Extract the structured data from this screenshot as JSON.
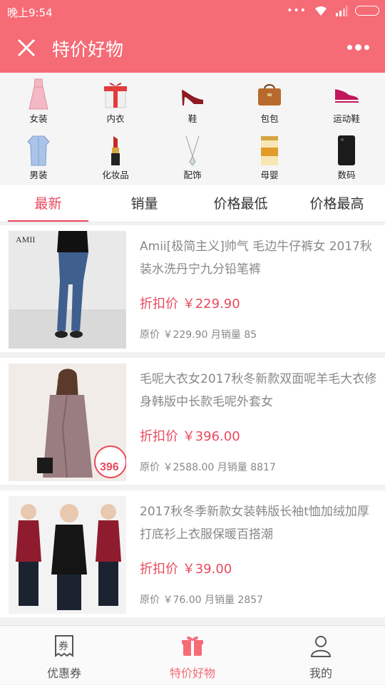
{
  "status_bar": {
    "time": "晚上9:54",
    "dots": "•••"
  },
  "header": {
    "title": "特价好物"
  },
  "categories": [
    {
      "label": "女装",
      "icon": "dress-icon"
    },
    {
      "label": "内衣",
      "icon": "gift-box-icon"
    },
    {
      "label": "鞋",
      "icon": "high-heel-icon"
    },
    {
      "label": "包包",
      "icon": "handbag-icon"
    },
    {
      "label": "运动鞋",
      "icon": "sneaker-icon"
    },
    {
      "label": "男装",
      "icon": "shirt-icon"
    },
    {
      "label": "化妆品",
      "icon": "lipstick-icon"
    },
    {
      "label": "配饰",
      "icon": "necklace-icon"
    },
    {
      "label": "母婴",
      "icon": "milk-powder-icon"
    },
    {
      "label": "数码",
      "icon": "smartphone-icon"
    }
  ],
  "tabs": [
    "最新",
    "销量",
    "价格最低",
    "价格最高"
  ],
  "active_tab": "最新",
  "products": [
    {
      "name": "Amii[极简主义]帅气 毛边牛仔裤女 2017秋装水洗丹宁九分铅笔裤",
      "price": "折扣价 ￥229.90",
      "meta": "原价 ￥229.90 月销量 85",
      "image_text": "AMII"
    },
    {
      "name": "毛呢大衣女2017秋冬新款双面呢羊毛大衣修身韩版中长款毛呢外套女",
      "price": "折扣价 ￥396.00",
      "meta": "原价 ￥2588.00 月销量 8817",
      "image_text": "396"
    },
    {
      "name": "2017秋冬季新款女装韩版长袖t恤加绒加厚打底衫上衣服保暖百搭潮",
      "price": "折扣价 ￥39.00",
      "meta": "原价 ￥76.00 月销量 2857",
      "image_text": ""
    }
  ],
  "bottom_nav": [
    {
      "label": "优惠券",
      "icon": "coupon-icon"
    },
    {
      "label": "特价好物",
      "icon": "gift-icon"
    },
    {
      "label": "我的",
      "icon": "user-icon"
    }
  ],
  "coupon_glyph": "券",
  "colors": {
    "accent": "#f56b76",
    "price": "#e94a5d"
  }
}
